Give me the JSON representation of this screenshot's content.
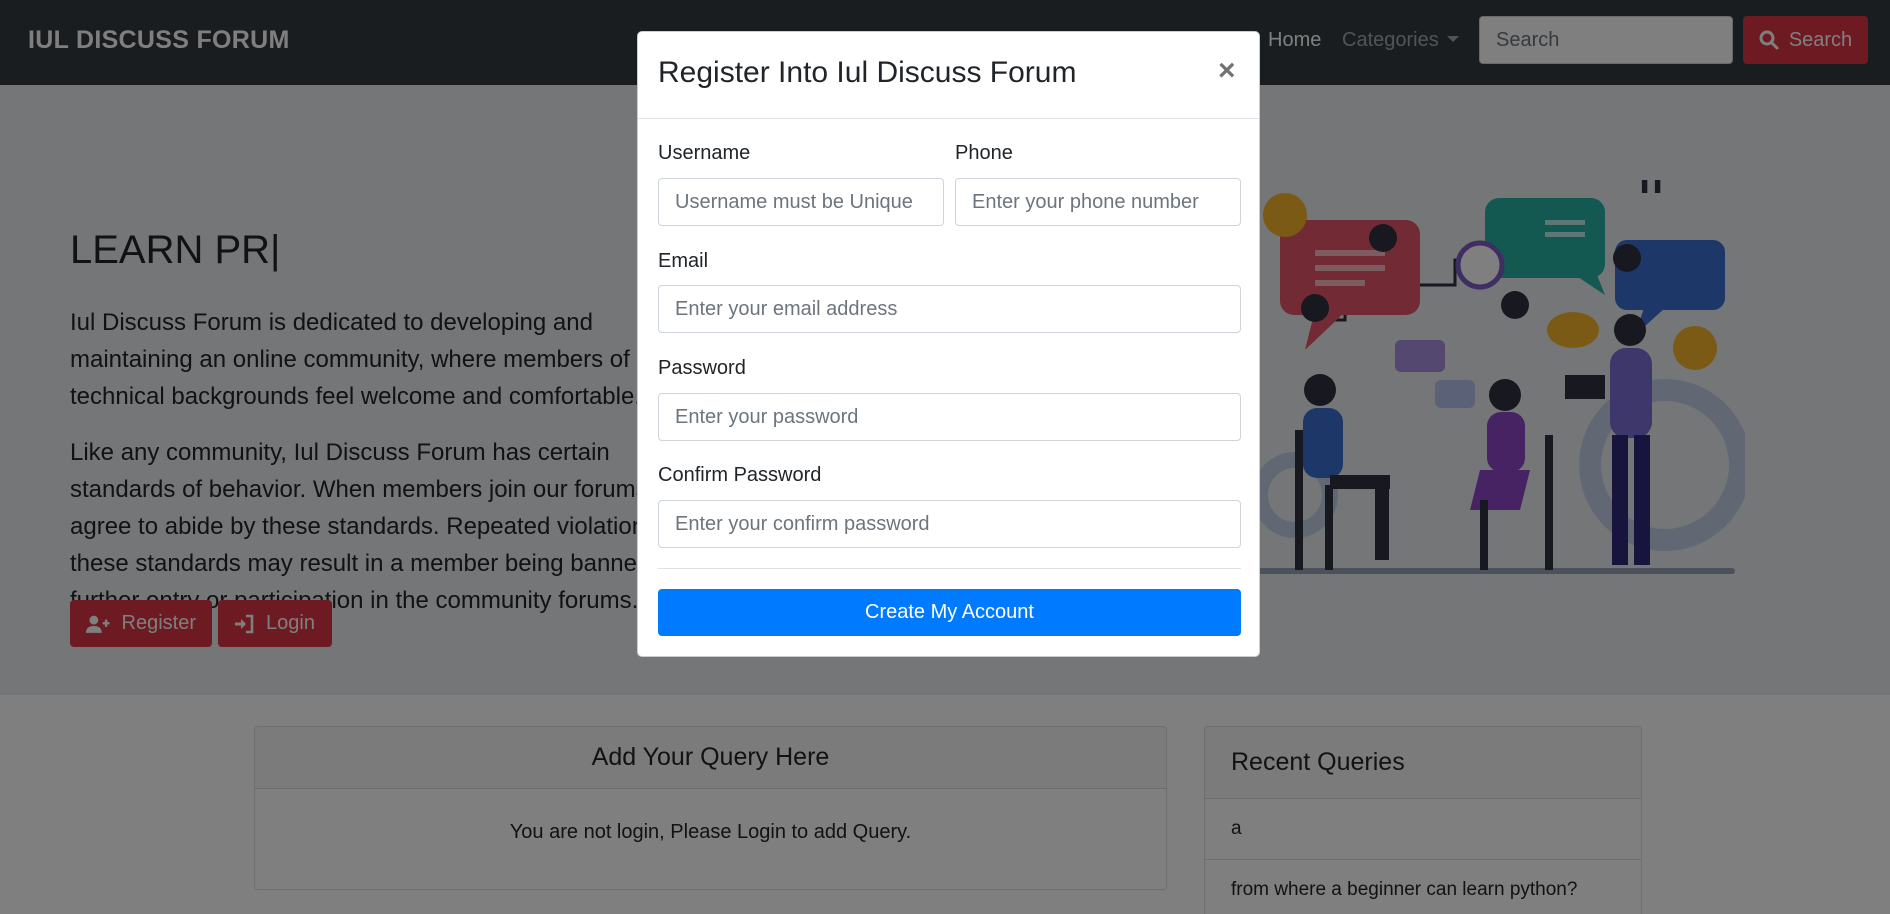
{
  "navbar": {
    "brand": "IUL DISCUSS FORUM",
    "home": "Home",
    "categories": "Categories",
    "search_placeholder": "Search",
    "search_button": "Search"
  },
  "hero": {
    "title": "LEARN PR|",
    "paragraph1": "Iul Discuss Forum is dedicated to developing and maintaining an online community, where members of all technical backgrounds feel welcome and comfortable.",
    "paragraph2": "Like any community, Iul Discuss Forum has certain standards of behavior. When members join our forums, they agree to abide by these standards. Repeated violations of these standards may result in a member being banned from further entry or participation in the community forums.",
    "register": "Register",
    "login": "Login"
  },
  "query_card": {
    "title": "Add Your Query Here",
    "message": "You are not login, Please Login to add Query."
  },
  "recent_card": {
    "title": "Recent Queries",
    "items": [
      "a",
      "from where a beginner can learn python?"
    ]
  },
  "modal": {
    "title": "Register Into Iul Discuss Forum",
    "close": "×",
    "username_label": "Username",
    "username_placeholder": "Username must be Unique",
    "phone_label": "Phone",
    "phone_placeholder": "Enter your phone number",
    "email_label": "Email",
    "email_placeholder": "Enter your email address",
    "password_label": "Password",
    "password_placeholder": "Enter your password",
    "confirm_label": "Confirm Password",
    "confirm_placeholder": "Enter your confirm password",
    "submit": "Create My Account"
  },
  "colors": {
    "navbar": "#343a40",
    "danger": "#dc3545",
    "primary": "#007bff",
    "jumbotron": "#e9ecef"
  }
}
